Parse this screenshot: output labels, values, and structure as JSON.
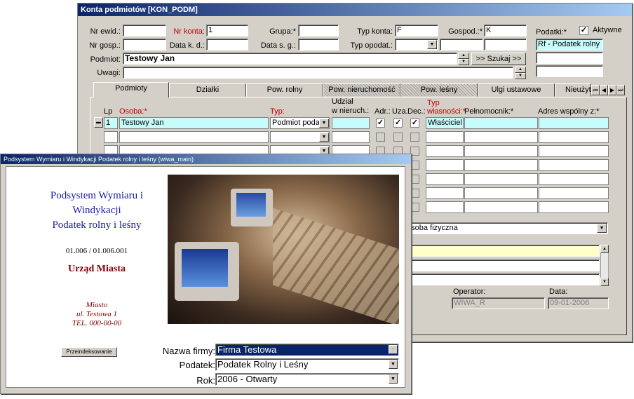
{
  "main_window": {
    "title": "Konta podmiotów [KON_PODM]",
    "fields": {
      "nr_ewid_label": "Nr ewid.:",
      "nr_konta_label": "Nr konta:",
      "nr_konta_value": "1",
      "grupa_label": "Grupa:*",
      "typ_konta_label": "Typ konta:",
      "typ_konta_value": "F",
      "gospod_label": "Gospod.:*",
      "gospod_value": "K",
      "podatki_label": "Podatki:*",
      "aktywne_label": "Aktywne",
      "nr_gosp_label": "Nr gosp.:",
      "data_kd_label": "Data k. d.:",
      "data_sg_label": "Data s. g.:",
      "typ_opodat_label": "Typ opodat.:",
      "podatek_value": "Rf - Podatek rolny",
      "podmiot_label": "Podmiot:",
      "podmiot_value": "Testowy Jan",
      "szukaj_label": ">> Szukaj >>",
      "uwagi_label": "Uwagi:"
    },
    "tabs": [
      {
        "label": "Podmioty"
      },
      {
        "label": "Działki"
      },
      {
        "label": "Pow. rolny"
      },
      {
        "label": "Pow. nieruchomość"
      },
      {
        "label": "Pow. leśny"
      },
      {
        "label": "Ulgi ustawowe"
      },
      {
        "label": "Nieużyt"
      }
    ],
    "grid": {
      "col_lp": "Lp",
      "col_osoba": "Osoba:*",
      "col_typ": "Typ:",
      "col_udzial_1": "Udział",
      "col_udzial_2": "w nieruch.:",
      "col_adr": "Adr.:",
      "col_uza": "Uza.",
      "col_dec": "Dec.:",
      "col_typ_wl_1": "Typ",
      "col_typ_wl_2": "własności:*",
      "col_pelnomocnik": "Pełnomocnik:*",
      "col_adres": "Adres wspólny z:*",
      "row1": {
        "lp": "1",
        "osoba": "Testowy Jan",
        "typ": "Podmiot poda",
        "typ_wlasnosci": "Właściciel"
      }
    },
    "osoba_type": "osoba fizyczna",
    "operator_label": "Operator:",
    "operator_value": "WIWA_R",
    "data_label": "Data:",
    "data_value": "09-01-2006"
  },
  "splash_window": {
    "title": "Podsystem Wymiaru i Windykacji Podatek rolny i leśny (wiwa_main)",
    "system_name_1": "Podsystem Wymiaru i",
    "system_name_2": "Windykacji",
    "system_name_3": "Podatek rolny i leśny",
    "version": "01.006 / 01.006.001",
    "org_name": "Urząd Miasta",
    "address_1": "Miasto",
    "address_2": "ul. Testowa 1",
    "address_3": "TEL. 000-00-00",
    "button_label": "Przeindeksowanie",
    "nazwa_firmy_label": "Nazwa firmy:",
    "nazwa_firmy_value": "Firma Testowa",
    "podatek_label": "Podatek:",
    "podatek_value": "Podatek Rolny i Leśny",
    "rok_label": "Rok:",
    "rok_value": "2006 - Otwarty"
  },
  "colors": {
    "title_gradient_start": "#0a246a",
    "title_gradient_end": "#a6caf0",
    "field_cyan": "#c8fcfc",
    "field_yellow": "#ffffc8",
    "required_red": "#c00000",
    "splash_blue": "#1a1aa0",
    "splash_darkred": "#800000",
    "selected_navy": "#0a246a"
  }
}
